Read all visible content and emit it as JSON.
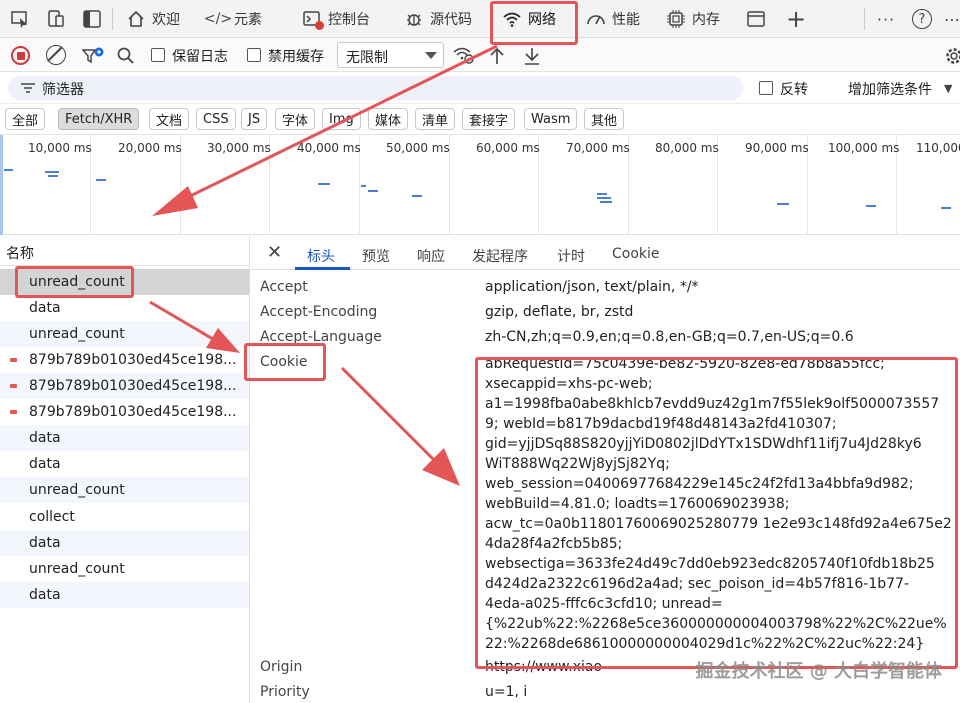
{
  "tabbar": {
    "tabs": [
      {
        "label": "欢迎",
        "icon": "home-icon"
      },
      {
        "label": "元素",
        "icon": "code-icon"
      },
      {
        "label": "控制台",
        "icon": "console-icon"
      },
      {
        "label": "源代码",
        "icon": "bug-icon"
      },
      {
        "label": "网络",
        "icon": "wifi-icon",
        "active": true
      },
      {
        "label": "性能",
        "icon": "gauge-icon"
      },
      {
        "label": "内存",
        "icon": "chip-icon"
      }
    ],
    "more_label": "···",
    "help_label": "?"
  },
  "toolbar": {
    "preserve_log": "保留日志",
    "disable_cache": "禁用缓存",
    "throttling": "无限制"
  },
  "filter": {
    "placeholder": "筛选器",
    "invert": "反转",
    "more_filters": "增加筛选条件"
  },
  "type_filters": [
    "全部",
    "Fetch/XHR",
    "文档",
    "CSS",
    "JS",
    "字体",
    "Img",
    "媒体",
    "清单",
    "套接字",
    "Wasm",
    "其他"
  ],
  "timeline": {
    "ticks": [
      "10,000 ms",
      "20,000 ms",
      "30,000 ms",
      "40,000 ms",
      "50,000 ms",
      "60,000 ms",
      "70,000 ms",
      "80,000 ms",
      "90,000 ms",
      "100,000 ms",
      "110,000"
    ]
  },
  "requests": {
    "header": "名称",
    "rows": [
      {
        "name": "unread_count",
        "selected": true
      },
      {
        "name": "data"
      },
      {
        "name": "unread_count"
      },
      {
        "name": "879b789b01030ed45ce198...",
        "error": true
      },
      {
        "name": "879b789b01030ed45ce198...",
        "error": true
      },
      {
        "name": "879b789b01030ed45ce198...",
        "error": true
      },
      {
        "name": "data"
      },
      {
        "name": "data"
      },
      {
        "name": "unread_count"
      },
      {
        "name": "collect"
      },
      {
        "name": "data"
      },
      {
        "name": "unread_count"
      },
      {
        "name": "data"
      }
    ]
  },
  "details": {
    "close": "✕",
    "tabs": [
      "标头",
      "预览",
      "响应",
      "发起程序",
      "计时",
      "Cookie"
    ],
    "headers": [
      {
        "name": "Accept",
        "value": "application/json, text/plain, */*"
      },
      {
        "name": "Accept-Encoding",
        "value": "gzip, deflate, br, zstd"
      },
      {
        "name": "Accept-Language",
        "value": "zh-CN,zh;q=0.9,en;q=0.8,en-GB;q=0.7,en-US;q=0.6"
      },
      {
        "name": "Cookie",
        "value": ""
      },
      {
        "name": "Origin",
        "value": "https://www.xiao"
      },
      {
        "name": "Priority",
        "value": "u=1, i"
      }
    ],
    "cookie_lines": [
      "abRequestId=75c0439e-be82-5920-82e8-ed78b8a55fcc;",
      "xsecappid=xhs-pc-web;",
      "a1=1998fba0abe8khlcb7evdd9uz42g1m7f55lek9olf5000073557",
      "9; webId=b817b9dacbd19f48d48143a2fd410307;",
      "gid=yjjDSq88S820yjjYiD0802jlDdYTx1SDWdhf11ifj7u4Jd28ky6",
      "WiT888Wq22Wj8yjSj82Yq;",
      "web_session=04006977684229e145c24f2fd13a4bbfa9d982;",
      "webBuild=4.81.0; loadts=1760069023938;",
      "acw_tc=0a0b11801760069025280779 1e2e93c148fd92a4e675e2",
      "4da28f4a2fcb5b85;",
      "websectiga=3633fe24d49c7dd0eb923edc8205740f10fdb18b25",
      "d424d2a2322c6196d2a4ad; sec_poison_id=4b57f816-1b77-",
      "4eda-a025-fffc6c3cfd10; unread=",
      "{%22ub%22:%2268e5ce360000000004003798%22%2C%22ue%",
      "22:%2268de68610000000004029d1c%22%2C%22uc%22:24}"
    ]
  },
  "watermark": "掘金技术社区 @ 大白学智能体"
}
